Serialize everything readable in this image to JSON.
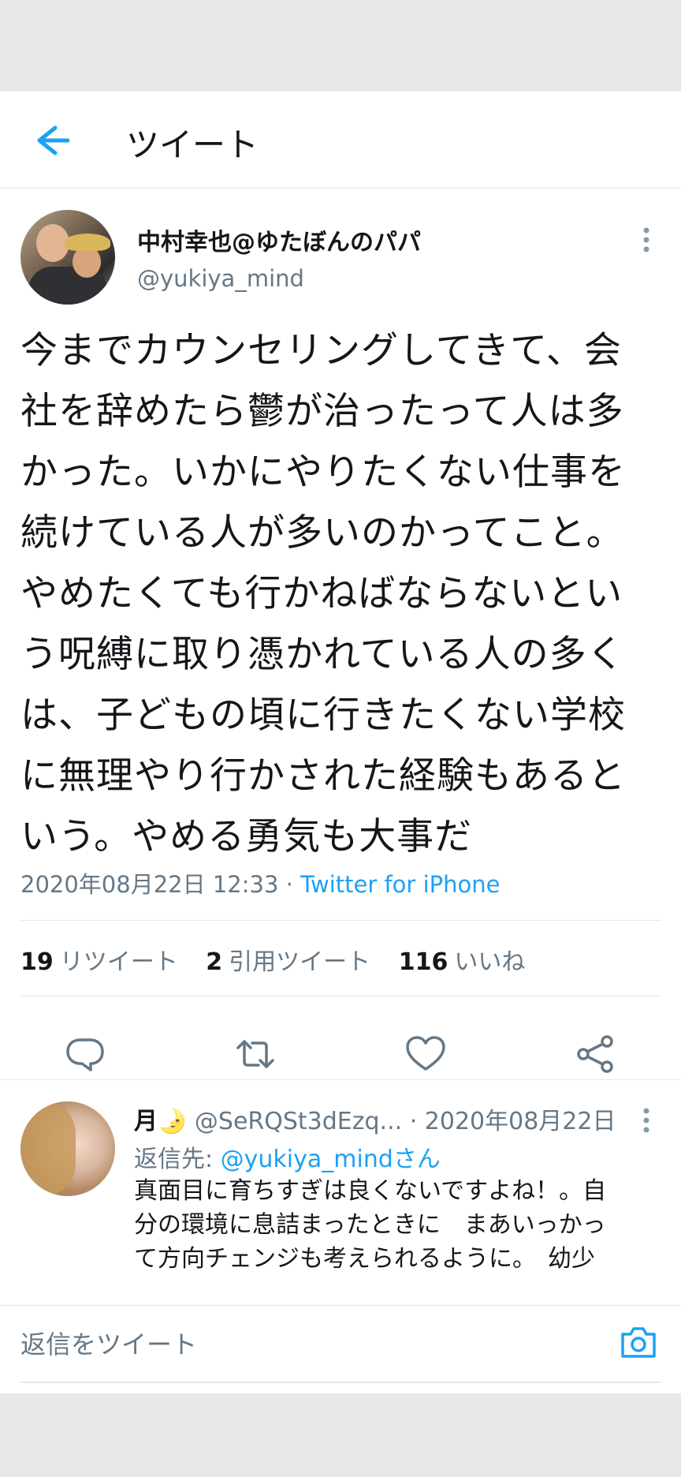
{
  "header": {
    "title": "ツイート"
  },
  "tweet": {
    "author_name": "中村幸也@ゆたぼんのパパ",
    "author_handle": "@yukiya_mind",
    "text": "今までカウンセリングしてきて、会\n社を辞めたら鬱が治ったって人は多\nかった。いかにやりたくない仕事を\n続けている人が多いのかってこと。\nやめたくても行かねばならないとい\nう呪縛に取り憑かれている人の多く\nは、子どもの頃に行きたくない学校\nに無理やり行かされた経験もあると\nいう。やめる勇気も大事だ",
    "timestamp": "2020年08月22日 12:33",
    "separator": " · ",
    "source": "Twitter for iPhone",
    "stats": {
      "retweets": {
        "count": "19",
        "label": "リツイート"
      },
      "quotes": {
        "count": "2",
        "label": "引用ツイート"
      },
      "likes": {
        "count": "116",
        "label": "いいね"
      }
    }
  },
  "reply": {
    "name": "月🌛",
    "handle": "@SeRQSt3dEzq...",
    "separator": " · ",
    "date": "2020年08月22日",
    "reply_to_label": "返信先: ",
    "reply_to_link": "@yukiya_mindさん",
    "text": "真面目に育ちすぎは良くないですよね！。自\n分の環境に息詰まったときに　まあいっかっ\nて方向チェンジも考えられるように。　幼少\n期から親が厳しいおうちが多いけど　厳しく"
  },
  "compose": {
    "placeholder": "返信をツイート"
  },
  "colors": {
    "accent": "#1da1f2",
    "muted": "#657786",
    "text": "#14171a",
    "divider": "#e1e8ed"
  },
  "icons": [
    "back-arrow-icon",
    "more-vertical-icon",
    "reply-icon",
    "retweet-icon",
    "like-icon",
    "share-icon",
    "camera-icon"
  ]
}
